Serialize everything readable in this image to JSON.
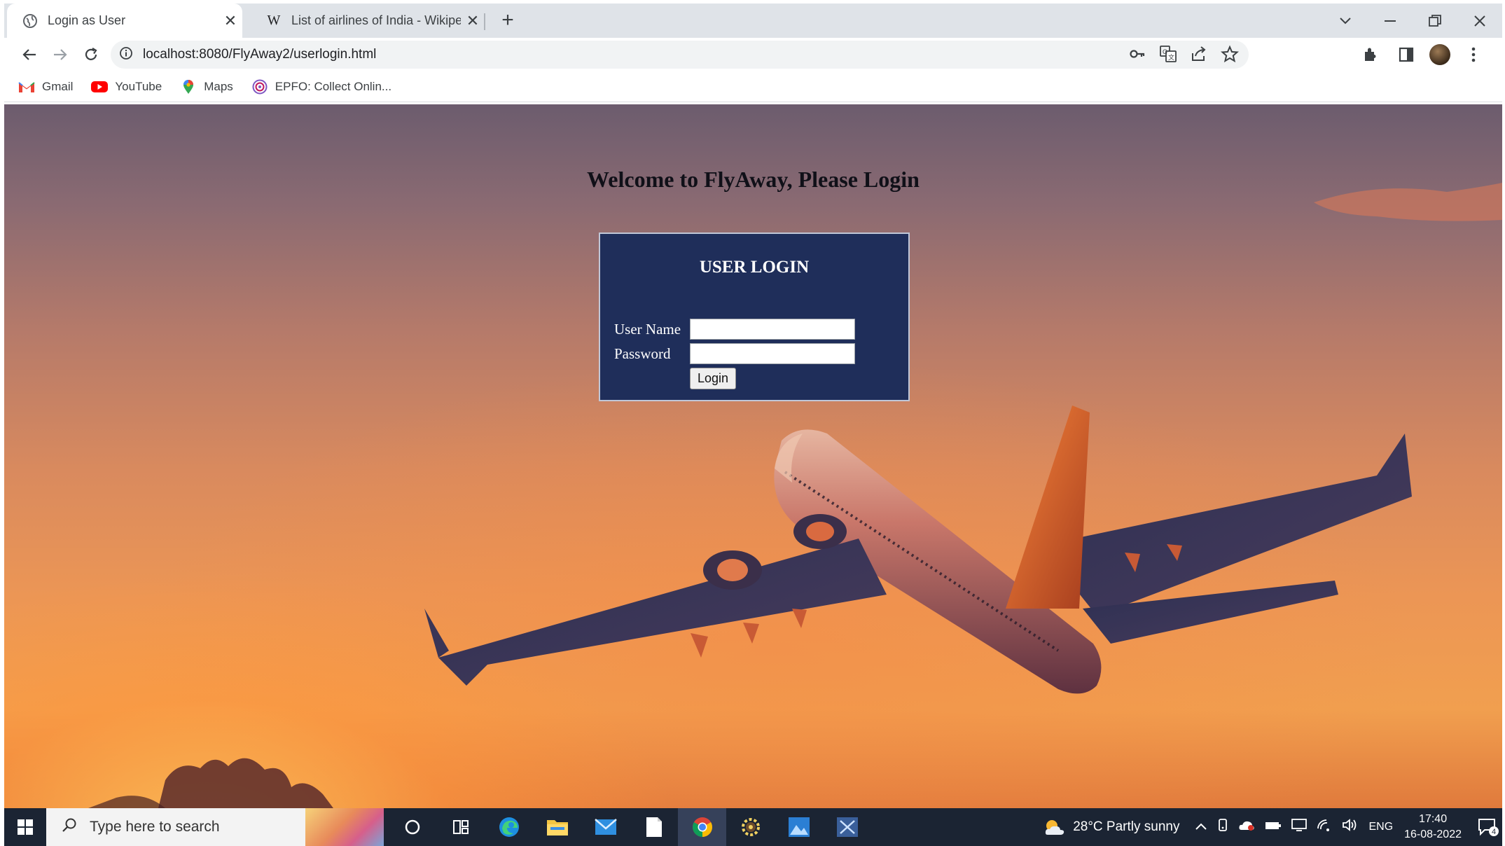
{
  "browser": {
    "tabs": [
      {
        "title": "Login as User",
        "active": true
      },
      {
        "title": "List of airlines of India - Wikipedia",
        "active": false
      }
    ],
    "url": "localhost:8080/FlyAway2/userlogin.html",
    "bookmarks": [
      {
        "label": "Gmail",
        "icon": "gmail-icon"
      },
      {
        "label": "YouTube",
        "icon": "youtube-icon"
      },
      {
        "label": "Maps",
        "icon": "maps-icon"
      },
      {
        "label": "EPFO: Collect Onlin...",
        "icon": "epfo-icon"
      }
    ]
  },
  "page": {
    "welcome_heading": "Welcome to FlyAway, Please Login",
    "login_title": "USER LOGIN",
    "username_label": "User Name",
    "username_value": "",
    "password_label": "Password",
    "password_value": "",
    "login_button": "Login"
  },
  "taskbar": {
    "search_placeholder": "Type here to search",
    "weather": "28°C  Partly sunny",
    "language": "ENG",
    "time": "17:40",
    "date": "16-08-2022",
    "notification_count": "4"
  },
  "colors": {
    "login_box_bg": "#1f2e5a",
    "taskbar_bg": "#1b2433",
    "tab_strip_bg": "#dfe3e8"
  }
}
